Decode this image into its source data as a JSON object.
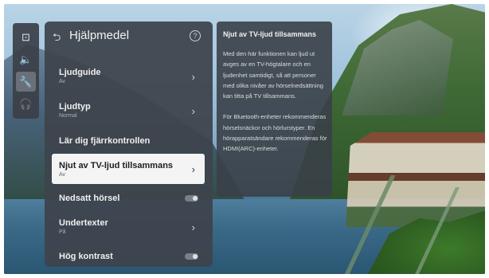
{
  "sidebar": {
    "icons": [
      {
        "name": "picture-icon",
        "glyph": "⊡"
      },
      {
        "name": "sound-icon",
        "glyph": "🔈"
      },
      {
        "name": "wrench-icon",
        "glyph": "🔧"
      },
      {
        "name": "headset-icon",
        "glyph": "🎧"
      }
    ],
    "active_index": 2
  },
  "panel": {
    "back_glyph": "⮌",
    "title": "Hjälpmedel",
    "help_glyph": "?",
    "items": [
      {
        "label": "Ljudguide",
        "sub": "Av",
        "type": "submenu"
      },
      {
        "label": "Ljudtyp",
        "sub": "Normal",
        "type": "submenu"
      },
      {
        "label": "Lär dig fjärrkontrollen",
        "sub": "",
        "type": "action"
      },
      {
        "label": "Njut av TV-ljud tillsammans",
        "sub": "Av",
        "type": "submenu",
        "focused": true
      },
      {
        "label": "Nedsatt hörsel",
        "sub": "",
        "type": "toggle",
        "on": false
      },
      {
        "label": "Undertexter",
        "sub": "På",
        "type": "submenu"
      },
      {
        "label": "Hög kontrast",
        "sub": "",
        "type": "toggle",
        "on": false
      }
    ]
  },
  "info": {
    "title": "Njut av TV-ljud tillsammans",
    "paragraph1": "Med den här funktionen kan ljud ut avges av en TV-högtalare och en ljudenhet samtidigt, så att personer med olika nivåer av hörselnedsättning kan titta på TV tillsammans.",
    "paragraph2": "För Bluetooth-enheter rekommenderas hörselsnäckor och hörlurstyper. En hörapparatsändare rekommenderas för HDMI(ARC)-enheter."
  },
  "colors": {
    "panel_bg": "#3e444c",
    "focus_bg": "#f4f4f4",
    "text_primary": "#f0f0f0"
  }
}
